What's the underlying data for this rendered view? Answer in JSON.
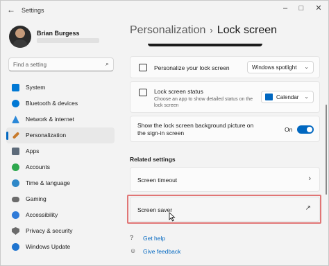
{
  "window": {
    "title": "Settings",
    "back_icon": "back-arrow-icon",
    "controls": [
      "minimize-icon",
      "maximize-icon",
      "close-icon"
    ]
  },
  "profile": {
    "name": "Brian Burgess"
  },
  "search": {
    "placeholder": "Find a setting",
    "icon": "search-icon"
  },
  "sidebar": {
    "items": [
      {
        "label": "System",
        "icon": "system-icon",
        "color": "#0078d4"
      },
      {
        "label": "Bluetooth & devices",
        "icon": "bluetooth-icon",
        "color": "#0078d4"
      },
      {
        "label": "Network & internet",
        "icon": "network-icon",
        "color": "#2b88d8"
      },
      {
        "label": "Personalization",
        "icon": "brush-icon",
        "color": "#c87a2c",
        "active": true
      },
      {
        "label": "Apps",
        "icon": "apps-icon",
        "color": "#5d6b7a"
      },
      {
        "label": "Accounts",
        "icon": "accounts-icon",
        "color": "#2ea84e"
      },
      {
        "label": "Time & language",
        "icon": "time-language-icon",
        "color": "#2f88c8"
      },
      {
        "label": "Gaming",
        "icon": "gaming-icon",
        "color": "#6b6b6b"
      },
      {
        "label": "Accessibility",
        "icon": "accessibility-icon",
        "color": "#2f7bd8"
      },
      {
        "label": "Privacy & security",
        "icon": "shield-icon",
        "color": "#6b6b6b"
      },
      {
        "label": "Windows Update",
        "icon": "windows-update-icon",
        "color": "#1f74cf"
      }
    ]
  },
  "header": {
    "parent": "Personalization",
    "separator": "›",
    "current": "Lock screen"
  },
  "settings": {
    "personalize": {
      "title": "Personalize your lock screen",
      "value": "Windows spotlight"
    },
    "status": {
      "title": "Lock screen status",
      "subtitle": "Choose an app to show detailed status on the lock screen",
      "value": "Calendar"
    },
    "background": {
      "title": "Show the lock screen background picture on the sign-in screen",
      "state": "On"
    }
  },
  "related": {
    "title": "Related settings",
    "items": [
      {
        "label": "Screen timeout",
        "icon": "chevron-right-icon"
      },
      {
        "label": "Screen saver",
        "icon": "external-link-icon"
      }
    ]
  },
  "help": {
    "get_help": "Get help",
    "feedback": "Give feedback"
  },
  "colors": {
    "accent": "#0067c0",
    "highlight": "#e07575"
  }
}
